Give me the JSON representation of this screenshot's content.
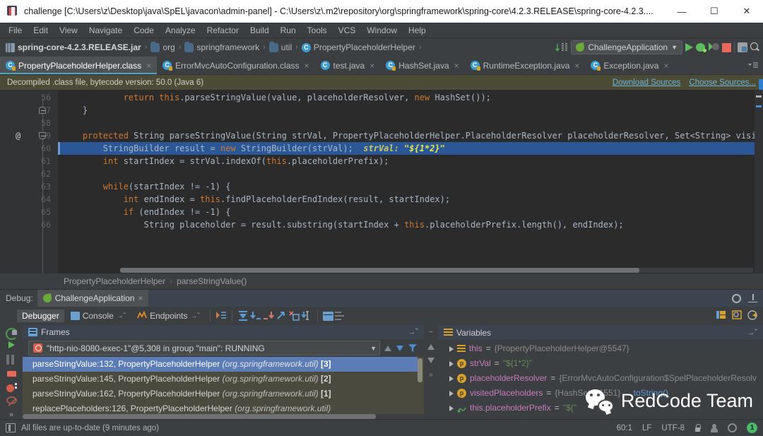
{
  "window": {
    "title": "challenge [C:\\Users\\z\\Desktop\\java\\SpEL\\javacon\\admin-panel] - C:\\Users\\z\\.m2\\repository\\org\\springframework\\spring-core\\4.2.3.RELEASE\\spring-core-4.2.3....",
    "minimize": "—",
    "maximize": "☐",
    "close": "✕"
  },
  "menubar": {
    "items": [
      "File",
      "Edit",
      "View",
      "Navigate",
      "Code",
      "Analyze",
      "Refactor",
      "Build",
      "Run",
      "Tools",
      "VCS",
      "Window",
      "Help"
    ]
  },
  "navbar": {
    "crumbs": [
      {
        "label": "spring-core-4.2.3.RELEASE.jar",
        "icon": "jar-icon"
      },
      {
        "label": "org",
        "icon": "folder-icon"
      },
      {
        "label": "springframework",
        "icon": "folder-icon"
      },
      {
        "label": "util",
        "icon": "folder-icon"
      },
      {
        "label": "PropertyPlaceholderHelper",
        "icon": "class-icon"
      }
    ],
    "separator": "›",
    "run_config": "ChallengeApplication",
    "caret": "▼"
  },
  "tabs": [
    {
      "label": "PropertyPlaceholderHelper.class",
      "icon": "class-file-icon",
      "active": true,
      "close": "×"
    },
    {
      "label": "ErrorMvcAutoConfiguration.class",
      "icon": "class-file-icon",
      "active": false,
      "close": "×"
    },
    {
      "label": "test.java",
      "icon": "class-icon",
      "active": false,
      "close": "×"
    },
    {
      "label": "HashSet.java",
      "icon": "class-file-icon",
      "active": false,
      "close": "×"
    },
    {
      "label": "RuntimeException.java",
      "icon": "class-file-icon",
      "active": false,
      "close": "×"
    },
    {
      "label": "Exception.java",
      "icon": "class-file-icon",
      "active": false,
      "close": "×"
    }
  ],
  "notification": {
    "text": "Decompiled .class file, bytecode version: 50.0 (Java 6)",
    "download_sources": "Download Sources",
    "choose_sources": "Choose Sources..."
  },
  "editor": {
    "lines": [
      {
        "no": "56",
        "fold": "",
        "at": false
      },
      {
        "no": "57",
        "fold": "up",
        "at": false
      },
      {
        "no": "58",
        "fold": "",
        "at": false
      },
      {
        "no": "59",
        "fold": "down",
        "at": true
      },
      {
        "no": "60",
        "fold": "",
        "at": false
      },
      {
        "no": "61",
        "fold": "",
        "at": false
      },
      {
        "no": "62",
        "fold": "",
        "at": false
      },
      {
        "no": "63",
        "fold": "",
        "at": false
      },
      {
        "no": "64",
        "fold": "",
        "at": false
      },
      {
        "no": "65",
        "fold": "",
        "at": false
      },
      {
        "no": "66",
        "fold": "",
        "at": false
      }
    ],
    "code": [
      "            return this.parseStringValue(value, placeholderResolver, new HashSet());",
      "    }",
      "",
      "    protected String parseStringValue(String strVal, PropertyPlaceholderHelper.PlaceholderResolver placeholderResolver, Set<String> visitedPl",
      "        StringBuilder result = new StringBuilder(strVal);",
      "        int startIndex = strVal.indexOf(this.placeholderPrefix);",
      "",
      "        while(startIndex != -1) {",
      "            int endIndex = this.findPlaceholderEndIndex(result, startIndex);",
      "            if (endIndex != -1) {",
      "                String placeholder = result.substring(startIndex + this.placeholderPrefix.length(), endIndex);"
    ],
    "inline_hint_name": "strVal:",
    "inline_hint_value": "\"${1*2}\"",
    "highlight_line_index": 4
  },
  "editor_crumbs": {
    "class": "PropertyPlaceholderHelper",
    "separator": "›",
    "method": "parseStringValue()"
  },
  "debug": {
    "label": "Debug:",
    "session_tab": "ChallengeApplication",
    "session_close": "×",
    "toolbar_tabs": [
      {
        "label": "Debugger",
        "active": true
      },
      {
        "label": "Console",
        "active": false,
        "pin": "→˘"
      },
      {
        "label": "Endpoints",
        "active": false,
        "pin": "→˘"
      }
    ],
    "frames_title": "Frames",
    "variables_title": "Variables",
    "thread": "\"http-nio-8080-exec-1\"@5,308 in group \"main\": RUNNING",
    "thread_caret": "▼",
    "frames": [
      {
        "method": "parseStringValue:132,",
        "cls": "PropertyPlaceholderHelper",
        "pkg": "(org.springframework.util)",
        "badge": "[3]",
        "selected": true
      },
      {
        "method": "parseStringValue:145,",
        "cls": "PropertyPlaceholderHelper",
        "pkg": "(org.springframework.util)",
        "badge": "[2]",
        "selected": false
      },
      {
        "method": "parseStringValue:162,",
        "cls": "PropertyPlaceholderHelper",
        "pkg": "(org.springframework.util)",
        "badge": "[1]",
        "selected": false
      },
      {
        "method": "replacePlaceholders:126,",
        "cls": "PropertyPlaceholderHelper",
        "pkg": "(org.springframework.util)",
        "badge": "",
        "selected": false
      }
    ],
    "variables": [
      {
        "icon": "object-icon",
        "name": "this",
        "eq": "=",
        "value": "{PropertyPlaceholderHelper@5547}",
        "value_class": "",
        "link": ""
      },
      {
        "icon": "param-icon",
        "name": "strVal",
        "eq": "=",
        "value": "\"${1*2}\"",
        "value_class": "str",
        "link": ""
      },
      {
        "icon": "param-icon",
        "name": "placeholderResolver",
        "eq": "=",
        "value": "{ErrorMvcAutoConfiguration$SpelPlaceholderResolv",
        "value_class": "",
        "link": ""
      },
      {
        "icon": "param-icon",
        "name": "visitedPlaceholders",
        "eq": "=",
        "value": "{HashSet@5551} ...",
        "value_class": "",
        "link": "toString()"
      },
      {
        "icon": "field-icon",
        "name": "this.placeholderPrefix",
        "eq": "=",
        "value": "\"${\"",
        "value_class": "str",
        "link": ""
      }
    ]
  },
  "watermark": {
    "text": "RedCode Team"
  },
  "statusbar": {
    "message": "All files are up-to-date (9 minutes ago)",
    "position": "60:1",
    "line_sep": "LF",
    "encoding": "UTF-8",
    "badge": "1"
  }
}
